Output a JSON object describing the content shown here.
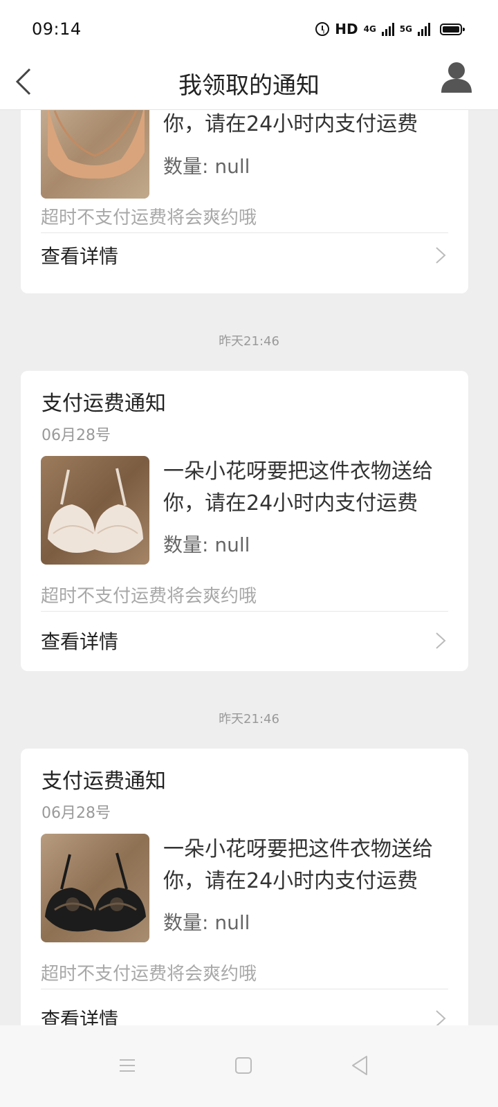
{
  "status_bar": {
    "time": "09:14",
    "hd": "HD",
    "net1": "4G",
    "net2": "5G"
  },
  "header": {
    "title": "我领取的通知"
  },
  "cards": [
    {
      "description": "你，请在24小时内支付运费",
      "quantity": "数量: null",
      "warning": "超时不支付运费将会爽约哦",
      "detail": "查看详情"
    },
    {
      "timestamp": "昨天21:46",
      "title": "支付运费通知",
      "date": "06月28号",
      "description": "一朵小花呀要把这件衣物送给你，请在24小时内支付运费",
      "quantity": "数量: null",
      "warning": "超时不支付运费将会爽约哦",
      "detail": "查看详情"
    },
    {
      "timestamp": "昨天21:46",
      "title": "支付运费通知",
      "date": "06月28号",
      "description": "一朵小花呀要把这件衣物送给你，请在24小时内支付运费",
      "quantity": "数量: null",
      "warning": "超时不支付运费将会爽约哦",
      "detail": "查看详情"
    }
  ],
  "icons": {
    "back": "chevron-left-icon",
    "user": "user-avatar-icon",
    "detail": "chevron-right-icon",
    "nav": [
      "menu-icon",
      "home-square-icon",
      "back-triangle-icon"
    ]
  },
  "colors": {
    "background": "#eeeeee",
    "card": "#ffffff",
    "muted": "#999999"
  }
}
